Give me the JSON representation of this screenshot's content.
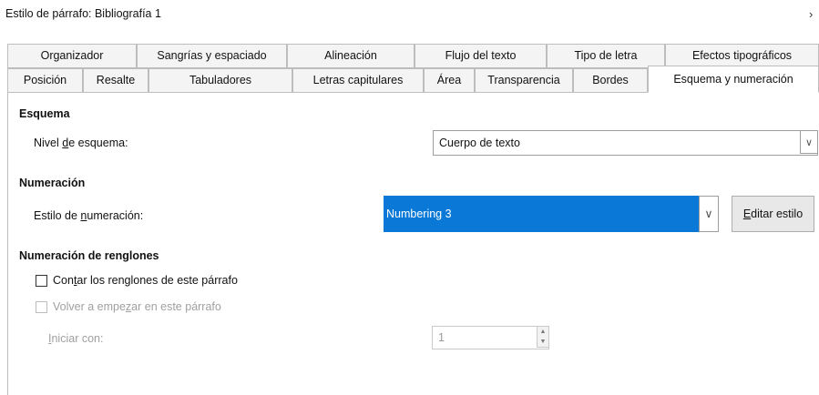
{
  "window": {
    "title": "Estilo de párrafo: Bibliografía 1",
    "close_glyph": "›"
  },
  "tabs": {
    "row1": [
      "Organizador",
      "Sangrías y espaciado",
      "Alineación",
      "Flujo del texto",
      "Tipo de letra",
      "Efectos tipográficos"
    ],
    "row2": [
      "Posición",
      "Resalte",
      "Tabuladores",
      "Letras capitulares",
      "Área",
      "Transparencia",
      "Bordes",
      "Esquema y numeración"
    ],
    "active": "Esquema y numeración"
  },
  "outline": {
    "heading": "Esquema",
    "level_label_pre": "Nivel ",
    "level_label_u": "d",
    "level_label_post": "e esquema:",
    "level_value": "Cuerpo de texto"
  },
  "numbering": {
    "heading": "Numeración",
    "style_label_pre": "Estilo de ",
    "style_label_u": "n",
    "style_label_post": "umeración:",
    "style_value": "Numbering 3",
    "edit_pre": "",
    "edit_u": "E",
    "edit_post": "ditar estilo"
  },
  "line_numbering": {
    "heading": "Numeración de renglones",
    "count_pre": "Con",
    "count_u": "t",
    "count_post": "ar los renglones de este párrafo",
    "restart_pre": "Volver a empe",
    "restart_u": "z",
    "restart_post": "ar en este párrafo",
    "start_pre": "",
    "start_u": "I",
    "start_post": "niciar con:",
    "start_value": "1"
  },
  "icons": {
    "dropdown": "chevron-down-icon",
    "spin": "spin-arrows-icon"
  }
}
